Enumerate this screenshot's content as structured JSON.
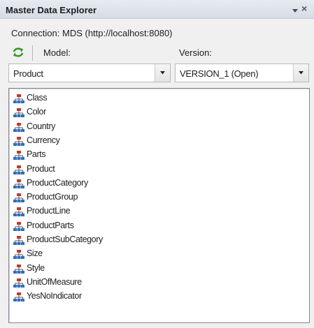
{
  "panel": {
    "title": "Master Data Explorer",
    "connection_text": "Connection: MDS (http://localhost:8080)"
  },
  "toolbar": {
    "refresh_icon": "refresh-icon",
    "model_label": "Model:",
    "version_label": "Version:"
  },
  "model_select": {
    "selected": "Product"
  },
  "version_select": {
    "selected": "VERSION_1 (Open)"
  },
  "entities": [
    {
      "label": "Class"
    },
    {
      "label": "Color"
    },
    {
      "label": "Country"
    },
    {
      "label": "Currency"
    },
    {
      "label": "Parts"
    },
    {
      "label": "Product"
    },
    {
      "label": "ProductCategory"
    },
    {
      "label": "ProductGroup"
    },
    {
      "label": "ProductLine"
    },
    {
      "label": "ProductParts"
    },
    {
      "label": "ProductSubCategory"
    },
    {
      "label": "Size"
    },
    {
      "label": "Style"
    },
    {
      "label": "UnitOfMeasure"
    },
    {
      "label": "YesNoIndicator"
    }
  ],
  "colors": {
    "refresh_green": "#3a9a2a",
    "entity_icon_red": "#c0392b",
    "entity_icon_blue": "#2f6fbf"
  }
}
